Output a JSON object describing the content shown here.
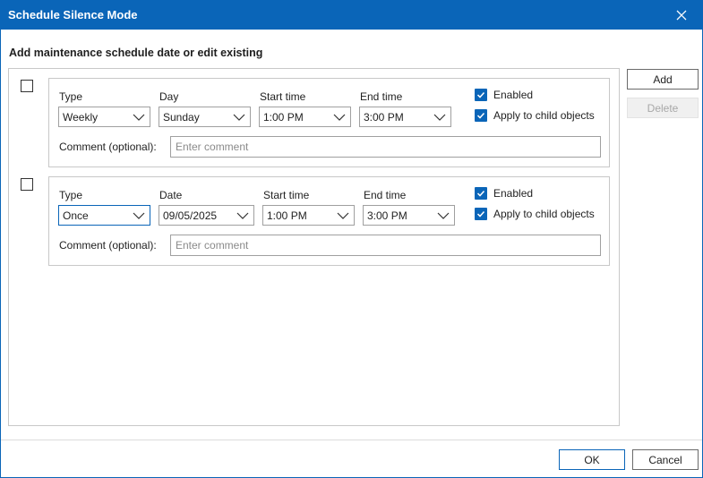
{
  "window": {
    "title": "Schedule Silence Mode"
  },
  "heading": "Add maintenance schedule date or edit existing",
  "entries": [
    {
      "type_label": "Type",
      "type_value": "Weekly",
      "second_label": "Day",
      "second_value": "Sunday",
      "start_label": "Start time",
      "start_value": "1:00 PM",
      "end_label": "End time",
      "end_value": "3:00 PM",
      "enabled_label": "Enabled",
      "enabled": true,
      "apply_label": "Apply to child objects",
      "apply": true,
      "comment_label": "Comment (optional):",
      "comment_placeholder": "Enter comment",
      "comment_value": ""
    },
    {
      "type_label": "Type",
      "type_value": "Once",
      "second_label": "Date",
      "second_value": "09/05/2025",
      "start_label": "Start time",
      "start_value": "1:00 PM",
      "end_label": "End time",
      "end_value": "3:00 PM",
      "enabled_label": "Enabled",
      "enabled": true,
      "apply_label": "Apply to child objects",
      "apply": true,
      "comment_label": "Comment (optional):",
      "comment_placeholder": "Enter comment",
      "comment_value": ""
    }
  ],
  "side_buttons": {
    "add": "Add",
    "delete": "Delete"
  },
  "footer": {
    "ok": "OK",
    "cancel": "Cancel"
  },
  "colors": {
    "accent": "#0a65b8",
    "border": "#c8c8c8"
  }
}
